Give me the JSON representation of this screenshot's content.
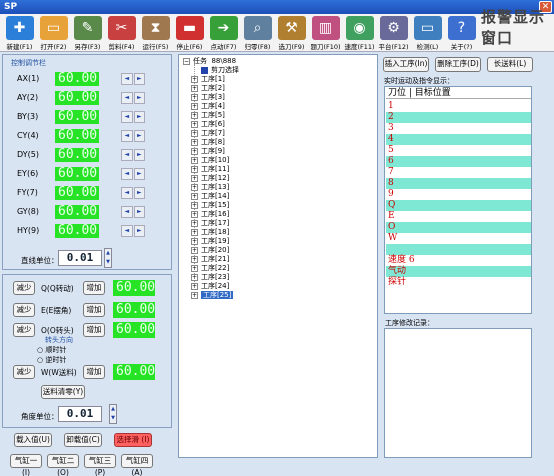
{
  "window": {
    "title": "SP"
  },
  "toolbar": {
    "items": [
      {
        "id": "new",
        "label": "新建(F1)",
        "color": "#2b7fd8",
        "glyph": "✚"
      },
      {
        "id": "open",
        "label": "打开(F2)",
        "color": "#e8a23a",
        "glyph": "▭"
      },
      {
        "id": "saveas",
        "label": "另存(F3)",
        "color": "#5a8a4a",
        "glyph": "✎"
      },
      {
        "id": "cut",
        "label": "剪料(F4)",
        "color": "#c94040",
        "glyph": "✂"
      },
      {
        "id": "run",
        "label": "运行(F5)",
        "color": "#a07850",
        "glyph": "⧗"
      },
      {
        "id": "stop",
        "label": "停止(F6)",
        "color": "#d03030",
        "glyph": "▬"
      },
      {
        "id": "jog",
        "label": "点动(F7)",
        "color": "#38a038",
        "glyph": "➔"
      },
      {
        "id": "zero",
        "label": "归零(F8)",
        "color": "#6080a0",
        "glyph": "⌕"
      },
      {
        "id": "tool",
        "label": "选刀(F9)",
        "color": "#b08030",
        "glyph": "⚒"
      },
      {
        "id": "library",
        "label": "题刀(F10)",
        "color": "#c05080",
        "glyph": "▥"
      },
      {
        "id": "speed",
        "label": "速度(F11)",
        "color": "#40a060",
        "glyph": "◉"
      },
      {
        "id": "platform",
        "label": "平台(F12)",
        "color": "#6a6a9a",
        "glyph": "⚙"
      },
      {
        "id": "monitor",
        "label": "检测(L)",
        "color": "#3f7fbf",
        "glyph": "▭"
      },
      {
        "id": "about",
        "label": "关于(?)",
        "color": "#3d6fd0",
        "glyph": "?"
      }
    ],
    "title_text": "报警显示窗口"
  },
  "control": {
    "group_label": "控制调节栏",
    "axes": [
      {
        "label": "AX(1)",
        "value": "60.00"
      },
      {
        "label": "AY(2)",
        "value": "60.00"
      },
      {
        "label": "BY(3)",
        "value": "60.00"
      },
      {
        "label": "CY(4)",
        "value": "60.00"
      },
      {
        "label": "DY(5)",
        "value": "60.00"
      },
      {
        "label": "EY(6)",
        "value": "60.00"
      },
      {
        "label": "FY(7)",
        "value": "60.00"
      },
      {
        "label": "GY(8)",
        "value": "60.00"
      },
      {
        "label": "HY(9)",
        "value": "60.00"
      }
    ],
    "unit_label": "直线单位：",
    "unit_value": "0.01"
  },
  "angle": {
    "rows": [
      {
        "dec": "减少",
        "label": "Q(Q转动)",
        "inc": "增加",
        "value": "60.00"
      },
      {
        "dec": "减少",
        "label": "E(E摆角)",
        "inc": "增加",
        "value": "60.00"
      },
      {
        "dec": "减少",
        "label": "O(O转头)",
        "inc": "增加",
        "value": "60.00"
      },
      {
        "dec": "减少",
        "label": "W(W送料)",
        "inc": "增加",
        "value": "60.00"
      }
    ],
    "direction_label": "转头方向",
    "cw": "顺时针",
    "ccw": "逆时针",
    "feed_zero": "送料清零(Y)",
    "unit_label": "角度单位：",
    "unit_value": "0.01"
  },
  "bottom": {
    "load": "载入值(U)",
    "unload": "卸载值(C)",
    "status": "选择滑 (I)",
    "cyl1": "气缸一(I)",
    "cyl2": "气缸二(O)",
    "cyl3": "气缸三(P)",
    "cyl4": "气缸四(A)"
  },
  "tree": {
    "root": "任务",
    "root_info": "88\\888",
    "selector": "剪刀选择",
    "items": [
      "工序[1]",
      "工序[2]",
      "工序[3]",
      "工序[4]",
      "工序[5]",
      "工序[6]",
      "工序[7]",
      "工序[8]",
      "工序[9]",
      "工序[10]",
      "工序[11]",
      "工序[12]",
      "工序[13]",
      "工序[14]",
      "工序[15]",
      "工序[16]",
      "工序[17]",
      "工序[18]",
      "工序[19]",
      "工序[20]",
      "工序[21]",
      "工序[22]",
      "工序[23]",
      "工序[24]",
      "工序[25]"
    ],
    "selected": "工序[25]"
  },
  "right": {
    "insert": "插入工序(In)",
    "delete": "删除工序(D)",
    "long_feed": "长送料(L)",
    "realtime_label": "实时运动及指令显示：",
    "col_tool": "刀位",
    "col_target": "目标位置",
    "rows": [
      "1",
      "2",
      "3",
      "4",
      "5",
      "6",
      "7",
      "8",
      "9",
      "Q",
      "E",
      "O",
      "W",
      "",
      "速度    6",
      "气动",
      "探针"
    ],
    "edit_log_label": "工序修改记录："
  }
}
